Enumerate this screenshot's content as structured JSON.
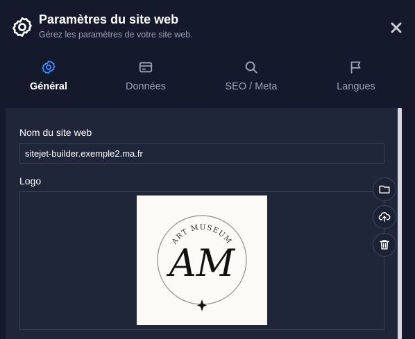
{
  "header": {
    "title": "Paramètres du site web",
    "subtitle": "Gérez les paramètres de votre site web.",
    "icon": "gear-icon",
    "close_icon": "close-icon"
  },
  "tabs": [
    {
      "label": "Général",
      "icon": "gear-icon",
      "active": true
    },
    {
      "label": "Données",
      "icon": "card-icon",
      "active": false
    },
    {
      "label": "SEO / Meta",
      "icon": "search-icon",
      "active": false
    },
    {
      "label": "Langues",
      "icon": "flag-icon",
      "active": false
    }
  ],
  "form": {
    "site_name_label": "Nom du site web",
    "site_name_value": "sitejet-builder.exemple2.ma.fr",
    "logo_label": "Logo"
  },
  "logo": {
    "arc_text": "ART MUSEUM",
    "monogram": "AM"
  },
  "side_actions": [
    {
      "name": "folder-icon"
    },
    {
      "name": "upload-icon"
    },
    {
      "name": "trash-icon"
    }
  ],
  "colors": {
    "background": "#141a2c",
    "panel": "#1f2639",
    "accent": "#3b8bff",
    "muted_text": "#9aa1b6",
    "border": "#3a4259"
  }
}
